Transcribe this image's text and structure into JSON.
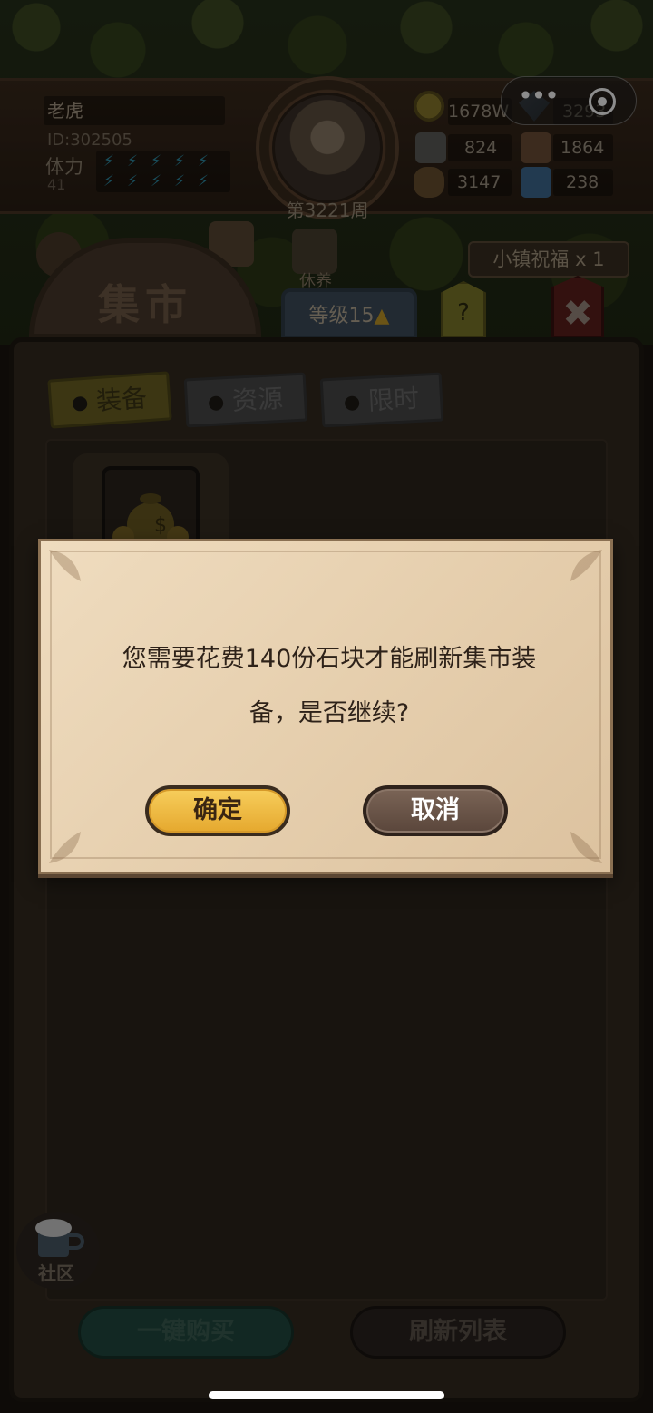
{
  "player": {
    "name": "老虎",
    "id_text": "ID:302505",
    "stamina_label": "体力",
    "stamina_value": "41",
    "week": "第3221周"
  },
  "resources": {
    "gold": "1678W",
    "diamond": "3293",
    "stone": "824",
    "fabric": "1864",
    "wood": "3147",
    "crystal": "238"
  },
  "mini_program_capsule": {
    "more_icon": "more-dots-icon",
    "close_icon": "target-close-icon"
  },
  "nav": {
    "market_title": "集市",
    "rest_label": "休养",
    "level_label": "等级15",
    "help_label": "?",
    "blessing_label": "小镇祝福 x 1",
    "close_label": "✖"
  },
  "market": {
    "tabs": [
      "装备",
      "资源",
      "限时"
    ],
    "active_tab": "装备"
  },
  "community": {
    "label": "社区"
  },
  "actions": {
    "buy_all": "一键购买",
    "refresh_list": "刷新列表"
  },
  "dialog": {
    "message": "您需要花费140份石块才能刷新集市装备，是否继续?",
    "confirm": "确定",
    "cancel": "取消"
  },
  "colors": {
    "confirm_button": "#e5a82e",
    "cancel_button": "#5a463b",
    "dialog_bg": "#e6cfae"
  }
}
